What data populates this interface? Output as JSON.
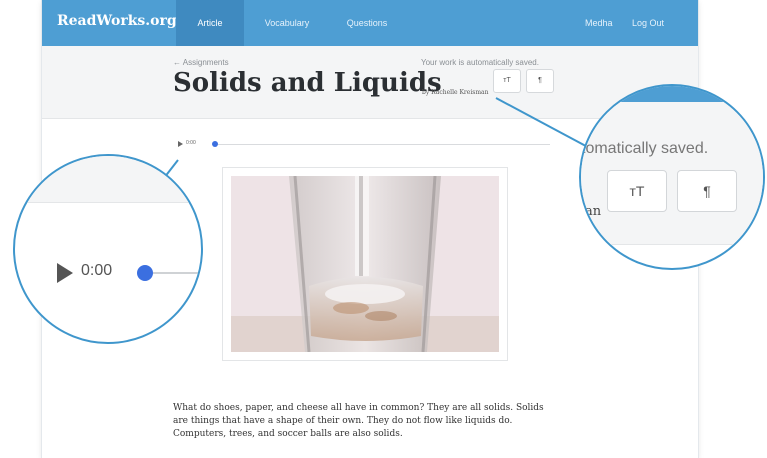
{
  "nav": {
    "brand": "ReadWorks.org",
    "tabs": [
      "Article",
      "Vocabulary",
      "Questions"
    ],
    "active_tab": "Article",
    "user_name": "Medha",
    "logout": "Log Out"
  },
  "header": {
    "back_link": "← Assignments",
    "autosave": "Your work is automatically saved.",
    "title": "Solids and Liquids",
    "byline": "by Rachelle Kreisman",
    "text_size_button": "ᴛT",
    "paragraph_button": "¶"
  },
  "audio": {
    "time": "0:00"
  },
  "article": {
    "paragraph": "What do shoes, paper, and cheese all have in common? They are all solids. Solids are things that have a shape of their own. They do not flow like liquids do. Computers, trees, and soccer balls are also solids."
  },
  "zoom_left": {
    "time": "0:00"
  },
  "zoom_right": {
    "autosave_fragment": "tomatically saved.",
    "text_size_button": "ᴛT",
    "paragraph_button": "¶",
    "byline_fragment": "an"
  },
  "colors": {
    "nav_blue": "#4e9ed3",
    "nav_active": "#3f8ac0",
    "zoom_outline": "#3f96cc",
    "audio_knob": "#3b6fe0"
  }
}
